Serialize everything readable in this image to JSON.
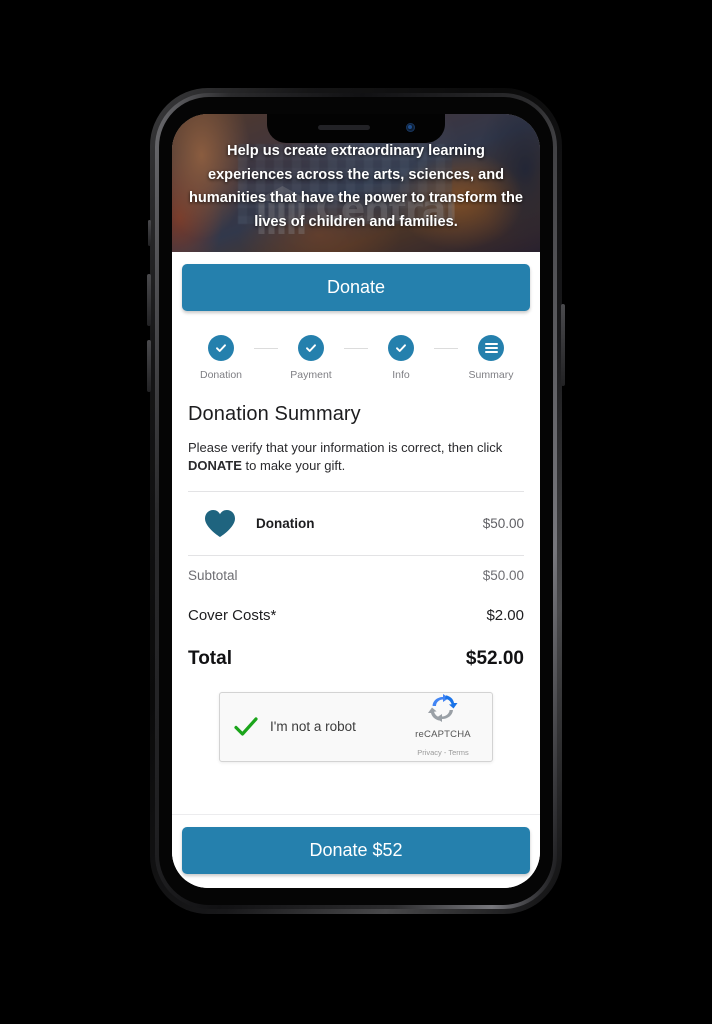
{
  "theme": {
    "accent": "#2580ad",
    "heart": "#1f647f",
    "step_circle": "#2580ad",
    "recaptcha_check": "#1ba51b",
    "page_background": "#000000",
    "screen_background": "#ffffff"
  },
  "hero": {
    "headline": "Help us create extraordinary learning experiences across the arts, sciences, and humanities that have the power to transform the lives of children and families.",
    "watermark_text": "Central",
    "watermark_icon": "building-columns-icon"
  },
  "top_bar": {
    "donate_label": "Donate"
  },
  "stepper": {
    "steps": [
      {
        "label": "Donation",
        "state": "complete",
        "icon": "check-icon"
      },
      {
        "label": "Payment",
        "state": "complete",
        "icon": "check-icon"
      },
      {
        "label": "Info",
        "state": "complete",
        "icon": "check-icon"
      },
      {
        "label": "Summary",
        "state": "current",
        "icon": "list-lines-icon"
      }
    ]
  },
  "summary": {
    "title": "Donation Summary",
    "verify_prefix": "Please verify that your information is correct, then click ",
    "verify_emphasis": "DONATE",
    "verify_suffix": " to make your gift.",
    "line_items": [
      {
        "icon": "heart-icon",
        "label": "Donation",
        "amount": "$50.00"
      }
    ],
    "totals": [
      {
        "label": "Subtotal",
        "value": "$50.00",
        "style": "sub"
      },
      {
        "label": "Cover Costs*",
        "value": "$2.00",
        "style": "cover"
      },
      {
        "label": "Total",
        "value": "$52.00",
        "style": "total"
      }
    ]
  },
  "recaptcha": {
    "label": "I'm not a robot",
    "brand": "reCAPTCHA",
    "links": "Privacy - Terms",
    "checked": true,
    "logo_icon": "recaptcha-logo-icon"
  },
  "bottom_bar": {
    "donate_label": "Donate $52"
  }
}
